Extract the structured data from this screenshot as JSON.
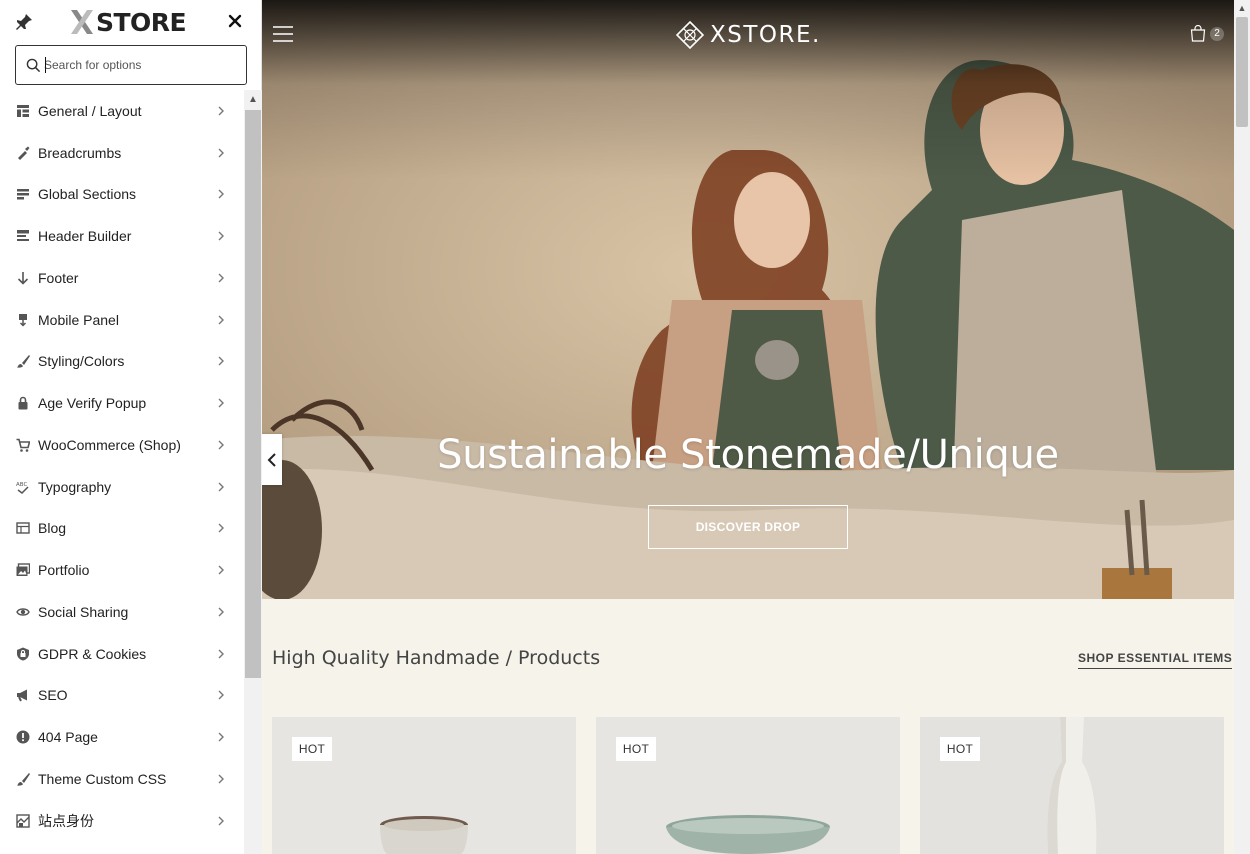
{
  "customizer": {
    "logo_text": "STORE",
    "search": {
      "placeholder": "Search for options",
      "value": ""
    },
    "menu": [
      {
        "label": "General / Layout",
        "icon": "layout-icon"
      },
      {
        "label": "Breadcrumbs",
        "icon": "breadcrumbs-icon"
      },
      {
        "label": "Global Sections",
        "icon": "sections-icon"
      },
      {
        "label": "Header Builder",
        "icon": "header-icon"
      },
      {
        "label": "Footer",
        "icon": "footer-arrow-icon"
      },
      {
        "label": "Mobile Panel",
        "icon": "mobile-icon"
      },
      {
        "label": "Styling/Colors",
        "icon": "brush-icon"
      },
      {
        "label": "Age Verify Popup",
        "icon": "lock-icon"
      },
      {
        "label": "WooCommerce (Shop)",
        "icon": "cart-icon"
      },
      {
        "label": "Typography",
        "icon": "typography-icon"
      },
      {
        "label": "Blog",
        "icon": "blog-icon"
      },
      {
        "label": "Portfolio",
        "icon": "portfolio-icon"
      },
      {
        "label": "Social Sharing",
        "icon": "visibility-icon"
      },
      {
        "label": "GDPR & Cookies",
        "icon": "shield-icon"
      },
      {
        "label": "SEO",
        "icon": "megaphone-icon"
      },
      {
        "label": "404 Page",
        "icon": "warning-icon"
      },
      {
        "label": "Theme Custom CSS",
        "icon": "brush-icon"
      },
      {
        "label": "站点身份",
        "icon": "site-identity-icon"
      }
    ]
  },
  "site": {
    "brand": "XSTORE.",
    "cart_count": "2",
    "hero": {
      "title": "Sustainable Stonemade/Unique",
      "cta": "DISCOVER DROP"
    },
    "section": {
      "title": "High Quality Handmade / Products",
      "link": "SHOP ESSENTIAL ITEMS"
    },
    "products": [
      {
        "badge": "HOT",
        "art": "cup"
      },
      {
        "badge": "HOT",
        "art": "bowl"
      },
      {
        "badge": "HOT",
        "art": "vase"
      }
    ]
  },
  "colors": {
    "accent": "#222222",
    "hero_tone": "#c4ad92",
    "page_bg": "#f6f3eb"
  }
}
